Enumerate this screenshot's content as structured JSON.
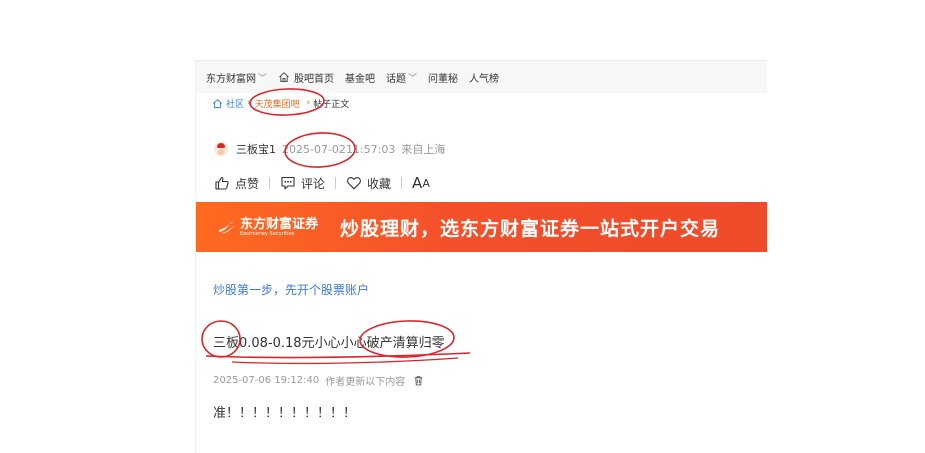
{
  "topnav": {
    "items": [
      {
        "label": "东方财富网",
        "has_dropdown": true
      },
      {
        "label": "股吧首页",
        "icon": "home-icon"
      },
      {
        "label": "基金吧"
      },
      {
        "label": "话题",
        "has_dropdown": true
      },
      {
        "label": "问董秘"
      },
      {
        "label": "人气榜"
      }
    ]
  },
  "breadcrumb": {
    "community": "社区",
    "bar": "天茂集团吧",
    "current": "帖子正文"
  },
  "author": {
    "name": "三板宝1",
    "date": "2025-07-02",
    "time": " 11:57:03",
    "location": "来自上海"
  },
  "actions": {
    "like": "点赞",
    "comment": "评论",
    "favorite": "收藏",
    "font_big": "A",
    "font_small": "A"
  },
  "banner": {
    "logo_cn": "东方财富证券",
    "logo_en": "Eastmoney Securities",
    "slogan": "炒股理财，选东方财富证券一站式开户交易"
  },
  "promo_link": "炒股第一步，先开个股票账户",
  "post": {
    "title": "三板0.08-0.18元小心小心破产清算归零",
    "updated_time": "2025-07-06 19:12:40",
    "updated_note": "作者更新以下内容",
    "content": "准！！！！！！！！！！"
  },
  "colors": {
    "link_blue": "#3b7ad8",
    "bar_orange": "#e86b1d",
    "banner_red": "#f4502b",
    "annotation_red": "#d8262c"
  }
}
